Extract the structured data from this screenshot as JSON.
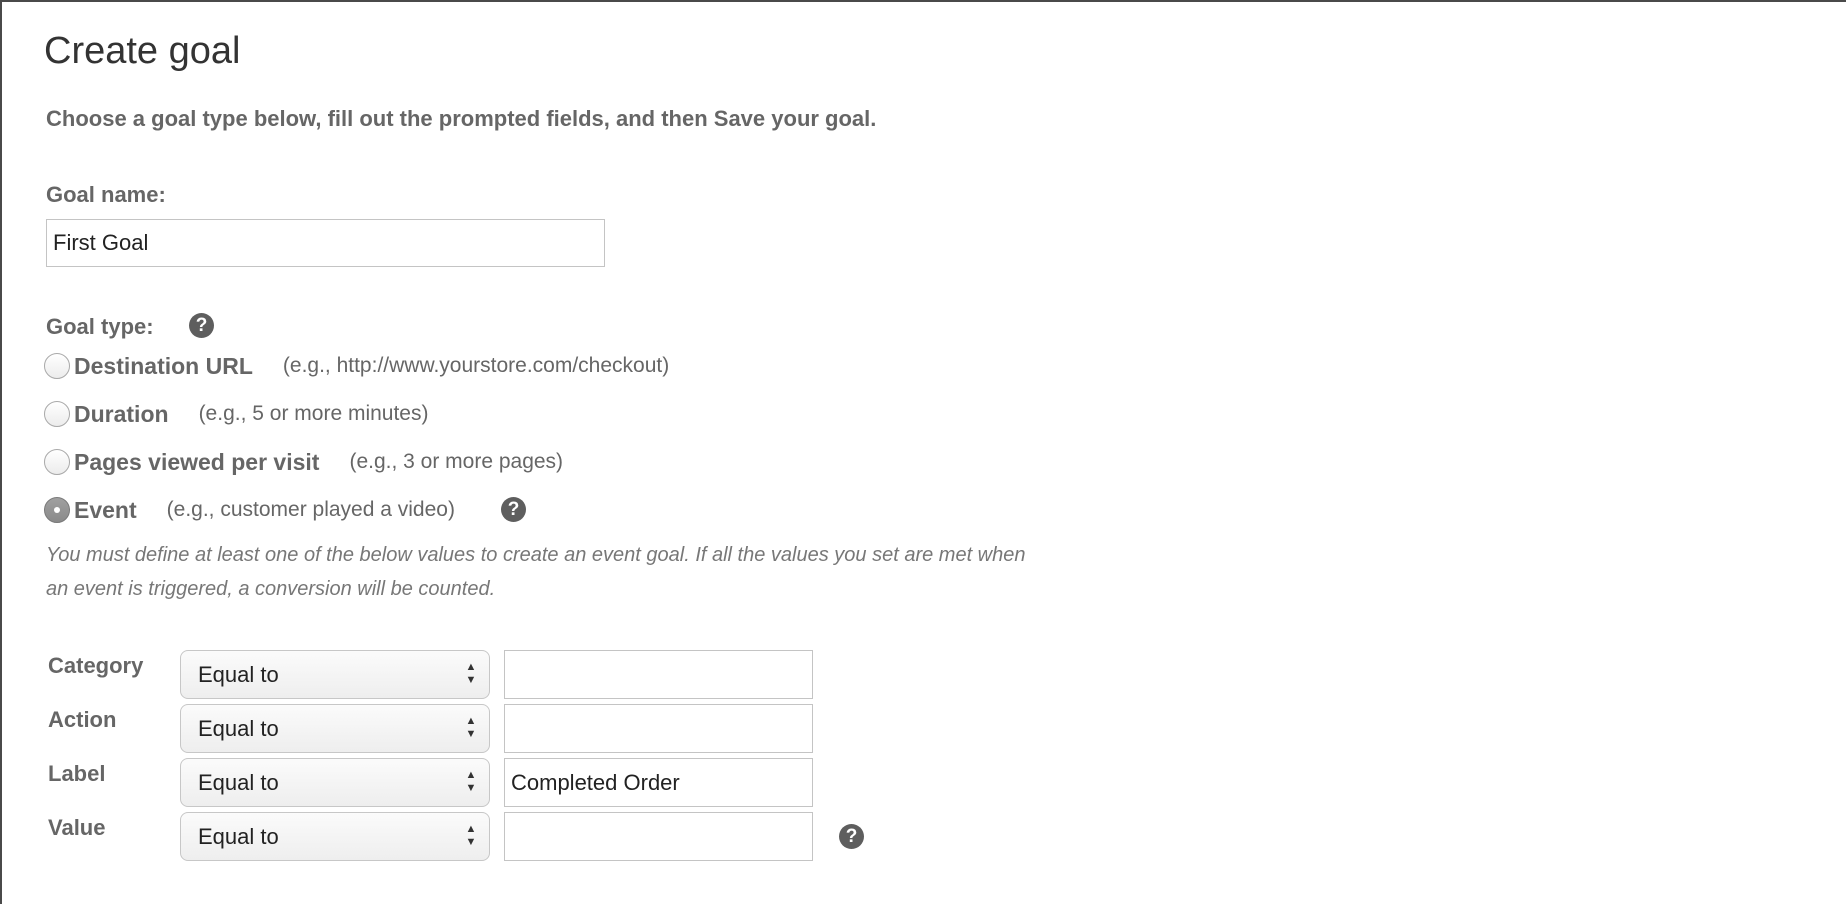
{
  "page": {
    "title": "Create goal",
    "intro": "Choose a goal type below, fill out the prompted fields, and then Save your goal."
  },
  "goal_name": {
    "label": "Goal name:",
    "value": "First Goal"
  },
  "goal_type": {
    "label": "Goal type:",
    "help_icon": "question-circle-icon",
    "options": [
      {
        "label": "Destination URL",
        "example": "(e.g., http://www.yourstore.com/checkout)",
        "selected": false
      },
      {
        "label": "Duration",
        "example": "(e.g., 5 or more minutes)",
        "selected": false
      },
      {
        "label": "Pages viewed per visit",
        "example": "(e.g., 3 or more pages)",
        "selected": false
      },
      {
        "label": "Event",
        "example": "(e.g., customer played a video)",
        "selected": true
      }
    ]
  },
  "event": {
    "note": "You must define at least one of the below values to create an event goal. If all the values you set are met when an event is triggered, a conversion will be counted.",
    "conditions": [
      {
        "label": "Category",
        "operator": "Equal to",
        "value": ""
      },
      {
        "label": "Action",
        "operator": "Equal to",
        "value": ""
      },
      {
        "label": "Label",
        "operator": "Equal to",
        "value": "Completed Order"
      },
      {
        "label": "Value",
        "operator": "Equal to",
        "value": ""
      }
    ]
  },
  "colors": {
    "border": "#4a4a4a",
    "text": "#666666",
    "help_icon": "#5e5e5e"
  }
}
